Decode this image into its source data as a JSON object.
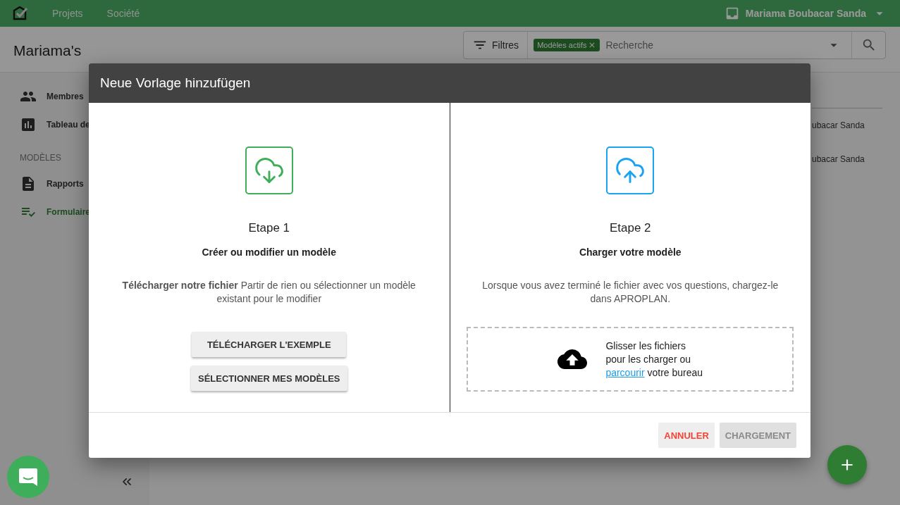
{
  "topbar": {
    "nav": [
      {
        "label": "Projets"
      },
      {
        "label": "Société"
      }
    ],
    "user": "Mariama Boubacar Sanda"
  },
  "header": {
    "title": "Mariama's",
    "filter_label": "Filtres",
    "chips": [
      {
        "label": "Modèles actifs"
      }
    ],
    "search": {
      "placeholder": "Recherche"
    }
  },
  "sidebar": {
    "groups": [
      {
        "items": [
          {
            "label": "Membres",
            "selected": false
          },
          {
            "label": "Tableau de",
            "selected": false
          }
        ]
      },
      {
        "heading": "MODÈLES",
        "items": [
          {
            "label": "Rapports",
            "selected": false
          },
          {
            "label": "Formulaire",
            "selected": true
          }
        ]
      }
    ]
  },
  "list": {
    "rows": [
      {
        "owner": "ubacar Sanda"
      },
      {
        "owner": "ubacar Sanda"
      }
    ]
  },
  "dialog": {
    "title": "Neue Vorlage hinzufügen",
    "steps": [
      {
        "kind": "download",
        "title": "Etape 1",
        "subtitle": "Créer ou modifier un modèle",
        "description": "**Télécharger notre fichier** Partir de rien ou sélectionner un modèle existant pour le modifier",
        "buttons": [
          {
            "label": "TÉLÉCHARGER L'EXEMPLE"
          },
          {
            "label": "SÉLECTIONNER MES MODÈLES"
          }
        ]
      },
      {
        "kind": "upload",
        "title": "Etape 2",
        "subtitle": "Charger votre modèle",
        "description": "Lorsque vous avez terminé le fichier avec vos questions, chargez-le dans APROPLAN.",
        "dropzone": {
          "lines": [
            "Glisser les fichiers",
            "pour les charger ou"
          ],
          "link": "parcourir",
          "after_link": "votre bureau"
        }
      }
    ],
    "actions": [
      {
        "kind": "cancel",
        "label": "ANNULER",
        "disabled": false
      },
      {
        "kind": "submit",
        "label": "CHARGEMENT",
        "disabled": true
      }
    ]
  }
}
